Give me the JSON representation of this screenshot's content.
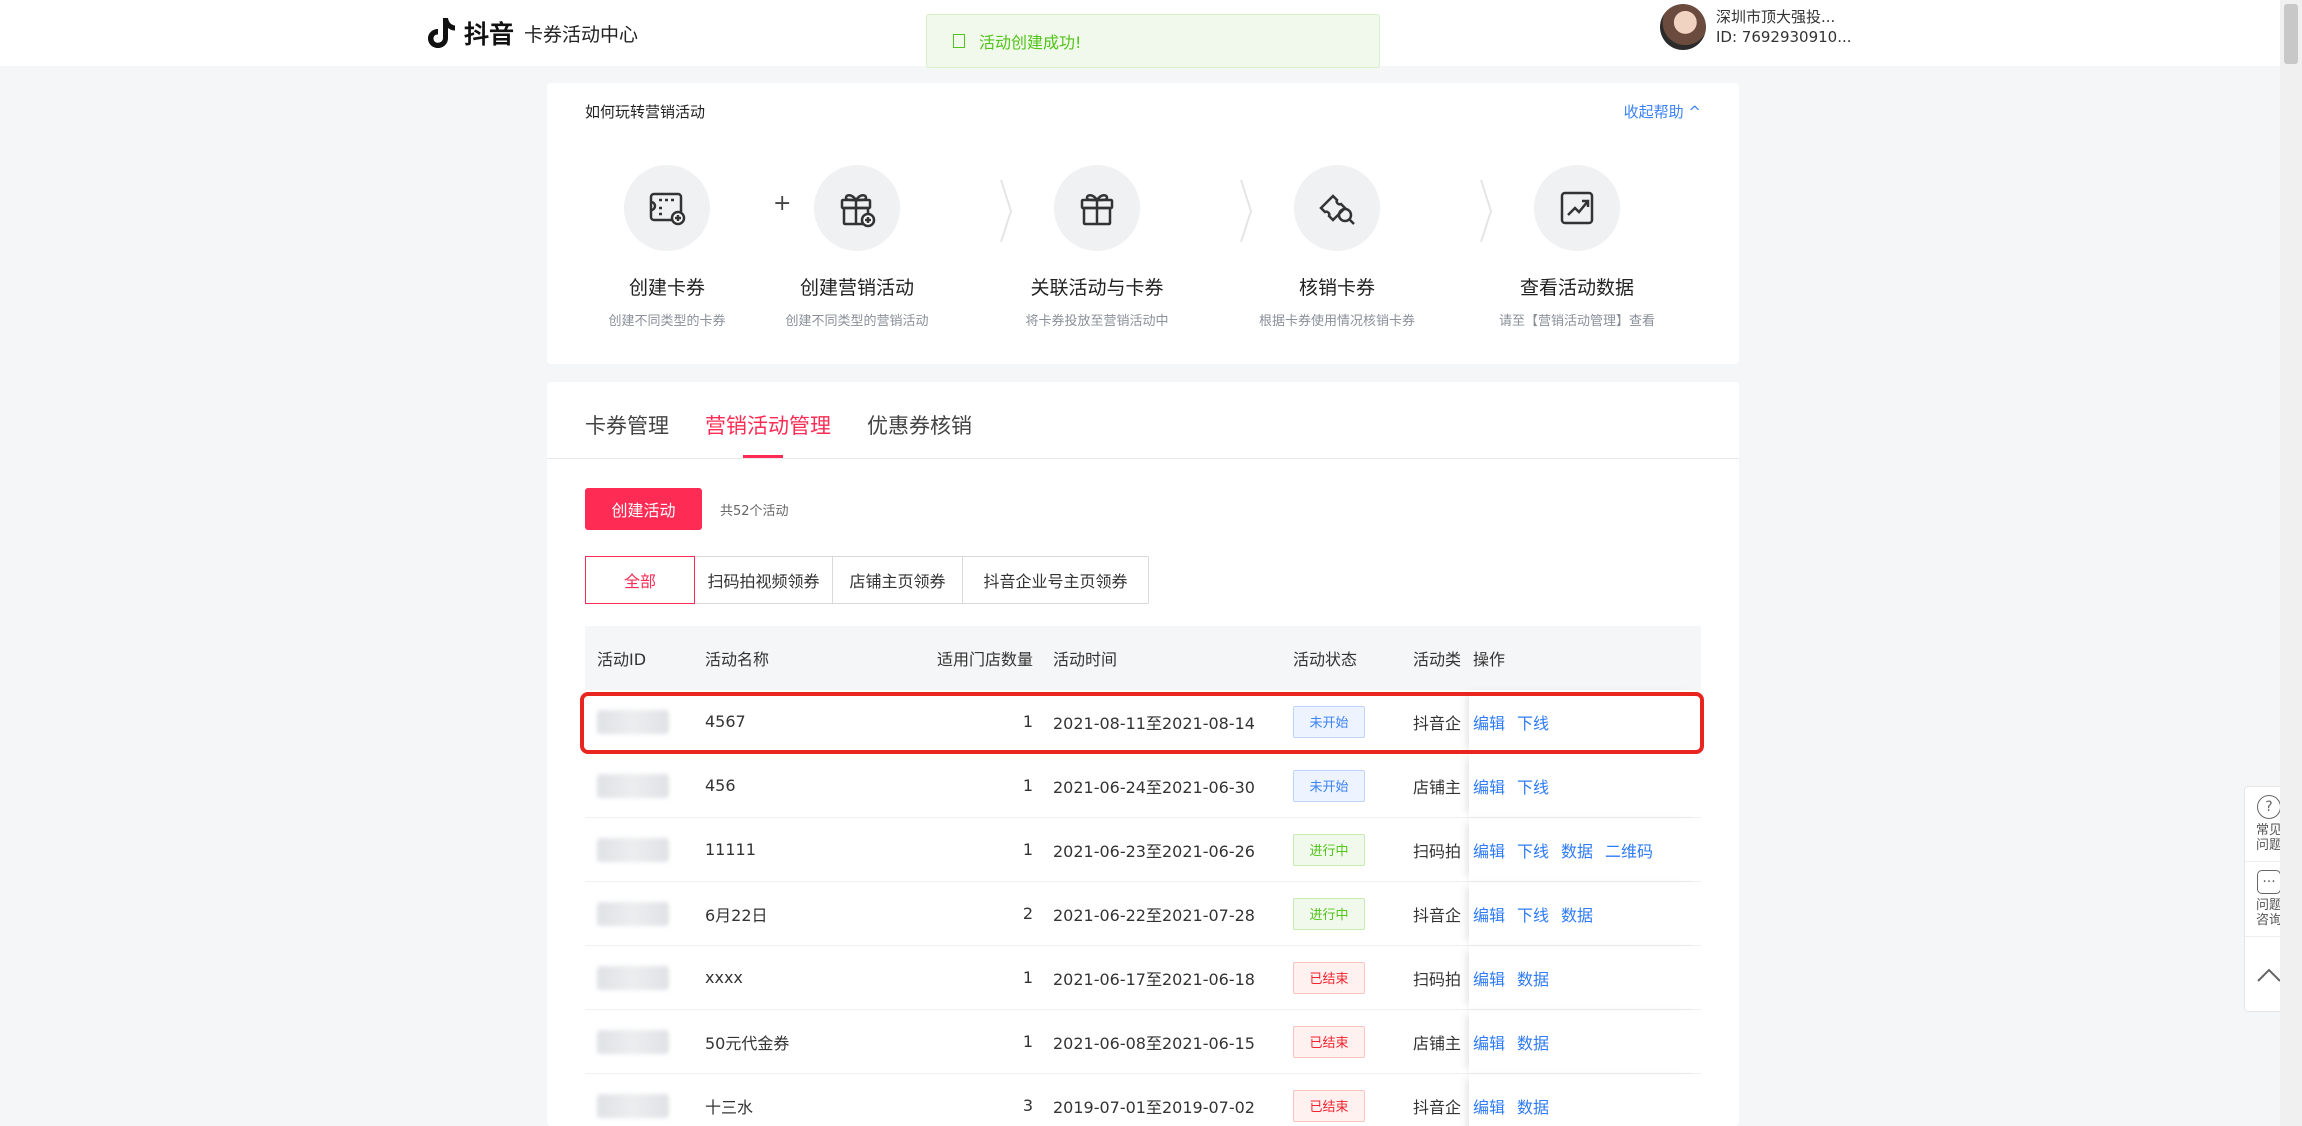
{
  "header": {
    "brand": "抖音",
    "subtitle": "卡券活动中心",
    "toast": "活动创建成功!",
    "user_name": "深圳市顶大强投...",
    "user_id": "ID: 7692930910..."
  },
  "help": {
    "title": "如何玩转营销活动",
    "toggle": "收起帮助 ^",
    "plus": "+",
    "steps": [
      {
        "title": "创建卡券",
        "desc": "创建不同类型的卡券",
        "icon": "coupon-create-icon"
      },
      {
        "title": "创建营销活动",
        "desc": "创建不同类型的营销活动",
        "icon": "gift-create-icon"
      },
      {
        "title": "关联活动与卡券",
        "desc": "将卡券投放至营销活动中",
        "icon": "gift-icon"
      },
      {
        "title": "核销卡券",
        "desc": "根据卡券使用情况核销卡券",
        "icon": "ticket-search-icon"
      },
      {
        "title": "查看活动数据",
        "desc": "请至【营销活动管理】查看",
        "icon": "chart-icon"
      }
    ]
  },
  "tabs": [
    "卡券管理",
    "营销活动管理",
    "优惠券核销"
  ],
  "create_button": "创建活动",
  "count_text": "共52个活动",
  "filters": [
    "全部",
    "扫码拍视频领券",
    "店铺主页领券",
    "抖音企业号主页领券"
  ],
  "table": {
    "headers": [
      "活动ID",
      "活动名称",
      "适用门店数量",
      "活动时间",
      "活动状态",
      "活动类",
      "操作"
    ],
    "rows": [
      {
        "name": "4567",
        "stores": "1",
        "time": "2021-08-11至2021-08-14",
        "status": "未开始",
        "status_type": "pending",
        "type": "抖音企",
        "ops": [
          "编辑",
          "下线"
        ]
      },
      {
        "name": "456",
        "stores": "1",
        "time": "2021-06-24至2021-06-30",
        "status": "未开始",
        "status_type": "pending",
        "type": "店铺主",
        "ops": [
          "编辑",
          "下线"
        ]
      },
      {
        "name": "11111",
        "stores": "1",
        "time": "2021-06-23至2021-06-26",
        "status": "进行中",
        "status_type": "running",
        "type": "扫码拍",
        "ops": [
          "编辑",
          "下线",
          "数据",
          "二维码"
        ]
      },
      {
        "name": "6月22日",
        "stores": "2",
        "time": "2021-06-22至2021-07-28",
        "status": "进行中",
        "status_type": "running",
        "type": "抖音企",
        "ops": [
          "编辑",
          "下线",
          "数据"
        ]
      },
      {
        "name": "xxxx",
        "stores": "1",
        "time": "2021-06-17至2021-06-18",
        "status": "已结束",
        "status_type": "ended",
        "type": "扫码拍",
        "ops": [
          "编辑",
          "数据"
        ]
      },
      {
        "name": "50元代金券",
        "stores": "1",
        "time": "2021-06-08至2021-06-15",
        "status": "已结束",
        "status_type": "ended",
        "type": "店铺主",
        "ops": [
          "编辑",
          "数据"
        ]
      },
      {
        "name": "十三水",
        "stores": "3",
        "time": "2019-07-01至2019-07-02",
        "status": "已结束",
        "status_type": "ended",
        "type": "抖音企",
        "ops": [
          "编辑",
          "数据"
        ]
      }
    ]
  },
  "float_panel": [
    {
      "label": "常见问题",
      "icon": "question-icon"
    },
    {
      "label": "问题咨询",
      "icon": "chat-icon"
    },
    {
      "label": "",
      "icon": "back-to-top-icon"
    }
  ],
  "colors": {
    "accent": "#fe2c55",
    "link": "#2f7bf5",
    "highlight": "#e8261f"
  }
}
